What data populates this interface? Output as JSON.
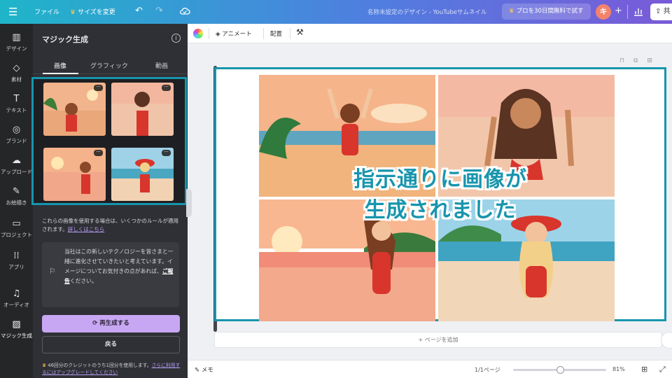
{
  "topbar": {
    "menu_icon": "hamburger-icon",
    "file": "ファイル",
    "resize": "サイズを変更",
    "doc_title": "名称未設定のデザイン - YouTubeサムネイル",
    "pro_cta": "プロを30日間無料で試す",
    "avatar_initial": "キ",
    "plus": "+",
    "share_label": "共",
    "brand_gradient": [
      "#1fb5c9",
      "#4f7ee0",
      "#7a5ad8"
    ]
  },
  "rail": {
    "items": [
      {
        "label": "デザイン",
        "icon": "layout-icon"
      },
      {
        "label": "素材",
        "icon": "shapes-icon"
      },
      {
        "label": "テキスト",
        "icon": "text-icon"
      },
      {
        "label": "ブランド",
        "icon": "brand-icon"
      },
      {
        "label": "アップロード",
        "icon": "upload-icon"
      },
      {
        "label": "お絵描き",
        "icon": "draw-icon"
      },
      {
        "label": "プロジェクト",
        "icon": "folder-icon"
      },
      {
        "label": "アプリ",
        "icon": "apps-icon"
      },
      {
        "label": "オーディオ",
        "icon": "music-icon"
      },
      {
        "label": "マジック生成",
        "icon": "magic-image-icon"
      }
    ]
  },
  "panel": {
    "title": "マジック生成",
    "tabs": [
      "画像",
      "グラフィック",
      "動画"
    ],
    "active_tab": "画像",
    "notice": "これらの画像を使用する場合は、いくつかのルールが適用されます。",
    "notice_link": "詳しくはこちら",
    "feedback_text": "当社はこの新しいテクノロジーを皆さまと一緒に進化させていきたいと考えています。イメージについてお気付きの点があれば、",
    "feedback_link": "ご報告",
    "feedback_tail": "ください。",
    "regenerate": "再生成する",
    "back": "戻る",
    "credit_text": "46回分のクレジットのうち1回分を使用します。",
    "credit_link": "さらに利用するにはアップグレードしてください",
    "accent": "#c7a7f3"
  },
  "toolbar": {
    "animate": "アニメート",
    "position": "配置"
  },
  "canvas": {
    "overlay_line1": "指示通りに画像が",
    "overlay_line2": "生成されました",
    "highlight_color": "#1795ad",
    "add_page": "+ ページを追加"
  },
  "bottombar": {
    "memo": "メモ",
    "pages": "1/1ページ",
    "zoom": "81%",
    "zoom_level": 0.5
  }
}
